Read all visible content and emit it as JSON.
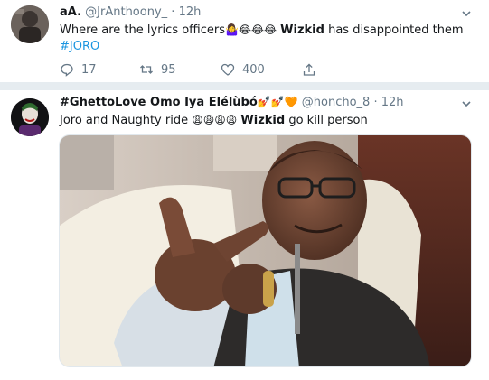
{
  "tweets": [
    {
      "name": "aA.",
      "handle": "@JrAnthoony_",
      "separator": "·",
      "time": "12h",
      "text_part1": "Where are the lyrics officers",
      "emojis1": "🤷‍♀️😂😂😂",
      "bold_word": "Wizkid",
      "text_part2": "has disappointed them",
      "hashtag": "#JORO",
      "actions": {
        "reply_count": "17",
        "retweet_count": "95",
        "like_count": "400"
      }
    },
    {
      "name": "#GhettoLove Omo Iya Elélùbó",
      "name_emojis": "💅💅🧡",
      "handle": "@honcho_8",
      "separator": "·",
      "time": "12h",
      "text_part1": "Joro and Naughty ride",
      "emojis1": "😩😩😩😩",
      "bold_word": "Wizkid",
      "text_part2": "go kill person"
    }
  ],
  "colors": {
    "link": "#1b95e0",
    "muted": "#657786",
    "divider": "#e6ecf0"
  },
  "icons": [
    "chevron-down-icon",
    "reply-icon",
    "retweet-icon",
    "like-icon",
    "share-icon"
  ]
}
